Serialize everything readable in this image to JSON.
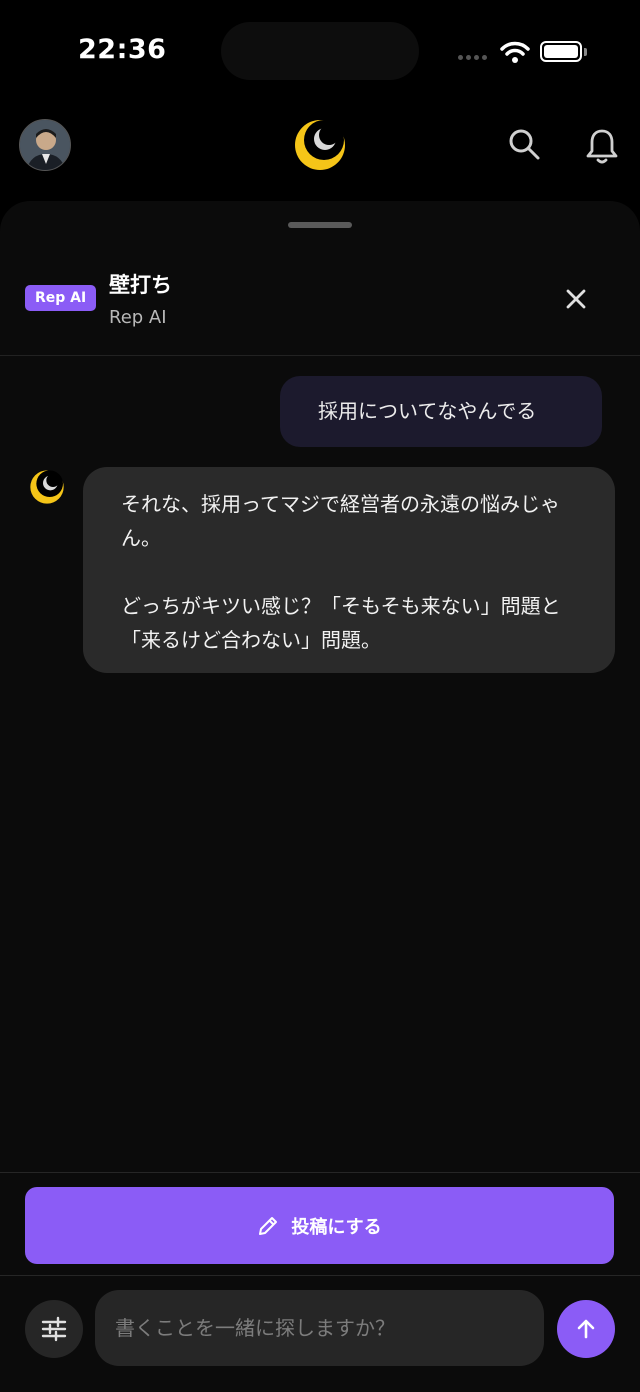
{
  "status_bar": {
    "time": "22:36"
  },
  "top_nav": {
    "avatar_icon": "user-avatar",
    "logo_icon": "crescent-moon-logo",
    "search_icon": "search-icon",
    "notifications_icon": "bell-icon"
  },
  "sheet": {
    "badge": "Rep AI",
    "title": "壁打ち",
    "subtitle": "Rep AI",
    "close_icon": "close-icon"
  },
  "messages": [
    {
      "role": "user",
      "text": "採用についてなやんでる"
    },
    {
      "role": "assistant",
      "paragraphs": [
        "それな、採用ってマジで経営者の永遠の悩みじゃん。",
        "どっちがキツい感じ？「そもそも来ない」問題と「来るけど合わない」問題。"
      ]
    }
  ],
  "actions": {
    "post_label": "投稿にする",
    "post_icon": "pencil-icon"
  },
  "composer": {
    "placeholder": "書くことを一緒に探しますか？",
    "value": "",
    "settings_icon": "sliders-icon",
    "send_icon": "arrow-up-icon"
  },
  "colors": {
    "accent": "#8b5cf6",
    "background": "#000000",
    "sheet_background": "#0b0b0b",
    "user_bubble": "#1c1a2d",
    "ai_bubble": "#2a2a2a",
    "logo_yellow": "#f5c518"
  }
}
